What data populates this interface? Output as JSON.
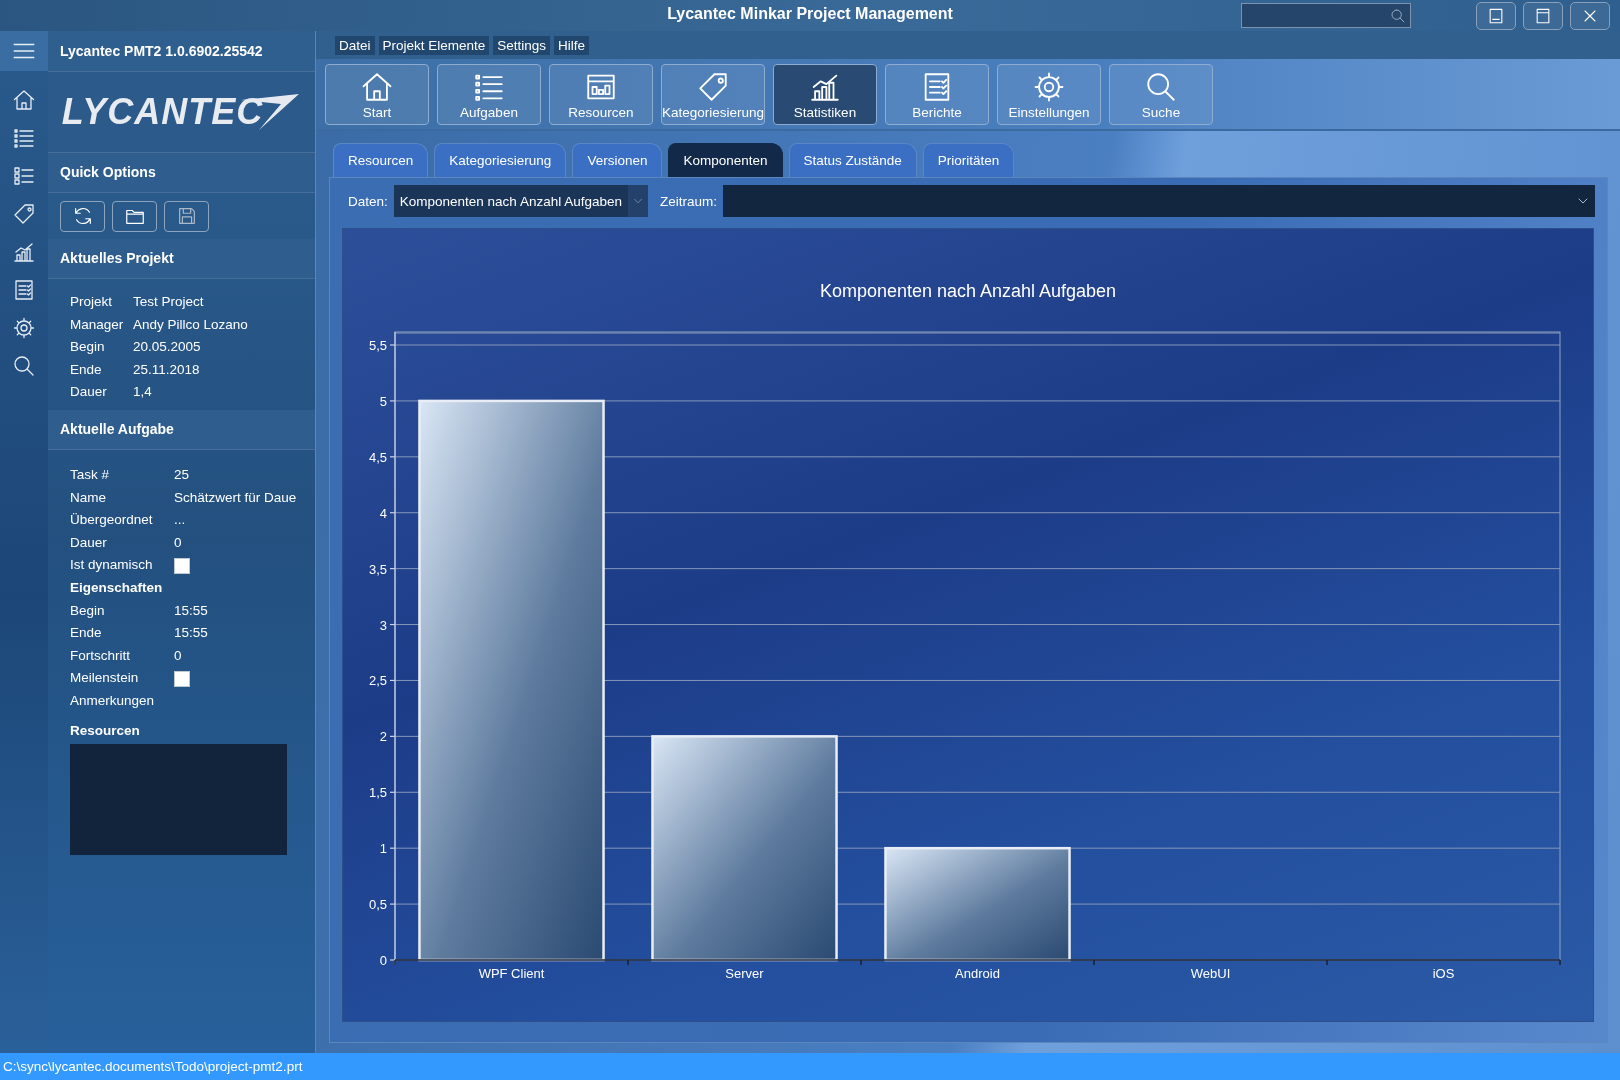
{
  "window": {
    "title": "Lycantec Minkar Project Management"
  },
  "app_header": {
    "version": "Lycantec PMT2 1.0.6902.25542",
    "logo": "LYCANTEC"
  },
  "menu": [
    "Datei",
    "Projekt Elemente",
    "Settings",
    "Hilfe"
  ],
  "toolbar": [
    {
      "label": "Start",
      "selected": false
    },
    {
      "label": "Aufgaben",
      "selected": false
    },
    {
      "label": "Resourcen",
      "selected": false
    },
    {
      "label": "Kategoriesierung",
      "selected": false
    },
    {
      "label": "Statistiken",
      "selected": true
    },
    {
      "label": "Berichte",
      "selected": false
    },
    {
      "label": "Einstellungen",
      "selected": false
    },
    {
      "label": "Suche",
      "selected": false
    }
  ],
  "quick_options": {
    "title": "Quick Options"
  },
  "current_project": {
    "title": "Aktuelles Projekt",
    "fields": [
      {
        "label": "Projekt",
        "value": "Test Project"
      },
      {
        "label": "Manager",
        "value": "Andy Pillco Lozano"
      },
      {
        "label": "Begin",
        "value": "20.05.2005"
      },
      {
        "label": "Ende",
        "value": "25.11.2018"
      },
      {
        "label": "Dauer",
        "value": "1,4"
      }
    ]
  },
  "current_task": {
    "title": "Aktuelle Aufgabe",
    "fields": [
      {
        "kind": "text",
        "label": "Task #",
        "value": "25"
      },
      {
        "kind": "text",
        "label": "Name",
        "value": "Schätzwert für Daue"
      },
      {
        "kind": "text",
        "label": "Übergeordnet",
        "value": "..."
      },
      {
        "kind": "text",
        "label": "Dauer",
        "value": "0"
      },
      {
        "kind": "checkbox",
        "label": "Ist dynamisch",
        "checked": false
      },
      {
        "kind": "heading",
        "label": "Eigenschaften"
      },
      {
        "kind": "text",
        "label": "Begin",
        "value": "15:55"
      },
      {
        "kind": "text",
        "label": "Ende",
        "value": "15:55"
      },
      {
        "kind": "text",
        "label": "Fortschritt",
        "value": "0"
      },
      {
        "kind": "checkbox",
        "label": "Meilenstein",
        "checked": false
      },
      {
        "kind": "label",
        "label": "Anmerkungen"
      }
    ],
    "resources_title": "Resourcen"
  },
  "tabs": [
    {
      "label": "Resourcen",
      "selected": false
    },
    {
      "label": "Kategoriesierung",
      "selected": false
    },
    {
      "label": "Versionen",
      "selected": false
    },
    {
      "label": "Komponenten",
      "selected": true
    },
    {
      "label": "Status Zustände",
      "selected": false
    },
    {
      "label": "Prioritäten",
      "selected": false
    }
  ],
  "filter": {
    "data_label": "Daten:",
    "data_value": "Komponenten nach Anzahl Aufgaben",
    "period_label": "Zeitraum:"
  },
  "chart": {
    "chart_data": {
      "type": "bar",
      "title": "Komponenten nach Anzahl Aufgaben",
      "categories": [
        "WPF Client",
        "Server",
        "Android",
        "WebUI",
        "iOS"
      ],
      "values": [
        5,
        2,
        1,
        0,
        0
      ],
      "grid": true,
      "ylim": [
        0,
        5.5
      ],
      "yticks": [
        {
          "value": 0,
          "label": "0"
        },
        {
          "value": 0.5,
          "label": "0,5"
        },
        {
          "value": 1,
          "label": "1"
        },
        {
          "value": 1.5,
          "label": "1,5"
        },
        {
          "value": 2,
          "label": "2"
        },
        {
          "value": 2.5,
          "label": "2,5"
        },
        {
          "value": 3,
          "label": "3"
        },
        {
          "value": 3.5,
          "label": "3,5"
        },
        {
          "value": 4,
          "label": "4"
        },
        {
          "value": 4.5,
          "label": "4,5"
        },
        {
          "value": 5,
          "label": "5"
        },
        {
          "value": 5.5,
          "label": "5,5"
        }
      ]
    }
  },
  "status_bar": {
    "path": "C:\\sync\\lycantec.documents\\Todo\\project-pmt2.prt"
  }
}
